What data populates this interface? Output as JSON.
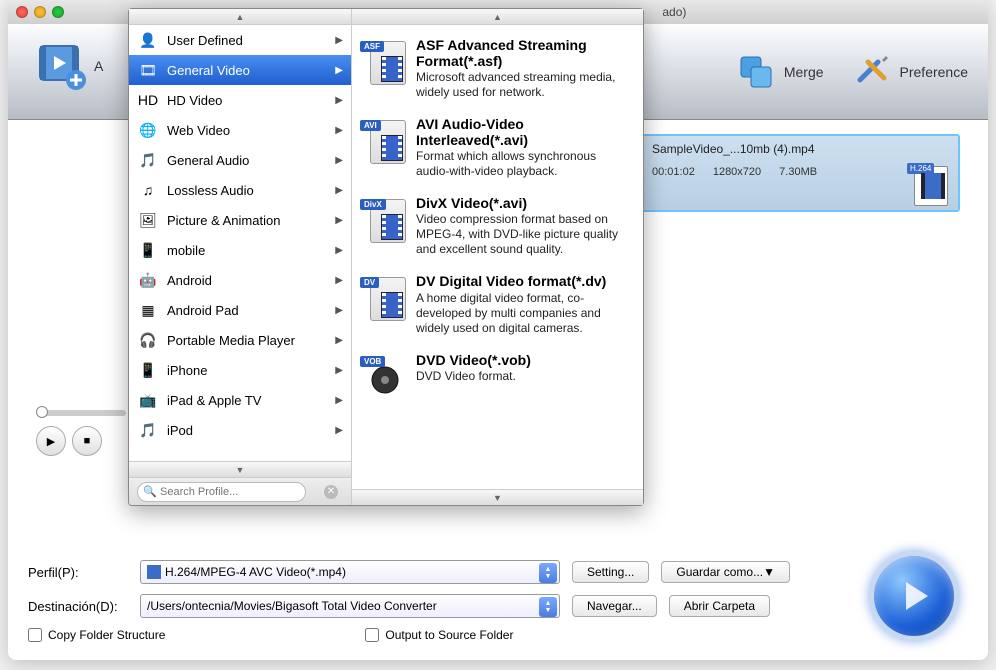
{
  "window": {
    "title_suffix": "ado)"
  },
  "toolbar": {
    "add_label_fragment": "A",
    "merge_label": "Merge",
    "preference_label": "Preference"
  },
  "file": {
    "name": "SampleVideo_...10mb (4).mp4",
    "duration": "00:01:02",
    "resolution": "1280x720",
    "size": "7.30MB",
    "codec_badge": "H.264"
  },
  "form": {
    "profile_label": "Perfil(P):",
    "profile_value": "H.264/MPEG-4 AVC Video(*.mp4)",
    "dest_label": "Destinación(D):",
    "dest_value": "/Users/ontecnia/Movies/Bigasoft Total Video Converter",
    "setting_btn": "Setting...",
    "save_as_btn": "Guardar como... ",
    "browse_btn": "Navegar...",
    "open_folder_btn": "Abrir Carpeta",
    "copy_folder_check": "Copy Folder Structure",
    "output_source_check": "Output to Source Folder"
  },
  "dropdown": {
    "search_placeholder": "Search Profile...",
    "categories": [
      {
        "icon": "👤",
        "label": "User Defined"
      },
      {
        "icon": "🎞",
        "label": "General Video",
        "selected": true
      },
      {
        "icon": "HD",
        "label": "HD Video"
      },
      {
        "icon": "🌐",
        "label": "Web Video"
      },
      {
        "icon": "🎵",
        "label": "General Audio"
      },
      {
        "icon": "♫",
        "label": "Lossless Audio"
      },
      {
        "icon": "🖼",
        "label": "Picture & Animation"
      },
      {
        "icon": "📱",
        "label": "mobile"
      },
      {
        "icon": "🤖",
        "label": "Android"
      },
      {
        "icon": "▦",
        "label": " Android Pad"
      },
      {
        "icon": "🎧",
        "label": "Portable Media Player"
      },
      {
        "icon": "📱",
        "label": "iPhone"
      },
      {
        "icon": "📺",
        "label": "iPad & Apple TV"
      },
      {
        "icon": "🎵",
        "label": "iPod"
      }
    ],
    "formats": [
      {
        "tag": "ASF",
        "title": "ASF Advanced Streaming Format(*.asf)",
        "desc": "Microsoft advanced streaming media, widely used for network."
      },
      {
        "tag": "AVI",
        "title": "AVI Audio-Video Interleaved(*.avi)",
        "desc": "Format which allows synchronous audio-with-video playback."
      },
      {
        "tag": "DivX",
        "title": "DivX Video(*.avi)",
        "desc": "Video compression format based on MPEG-4, with DVD-like picture quality and excellent sound quality."
      },
      {
        "tag": "DV",
        "title": "DV Digital Video format(*.dv)",
        "desc": "A home digital video format, co-developed by multi companies and widely used on digital cameras."
      },
      {
        "tag": "VOB",
        "title": "DVD Video(*.vob)",
        "desc": "DVD Video format."
      }
    ]
  }
}
